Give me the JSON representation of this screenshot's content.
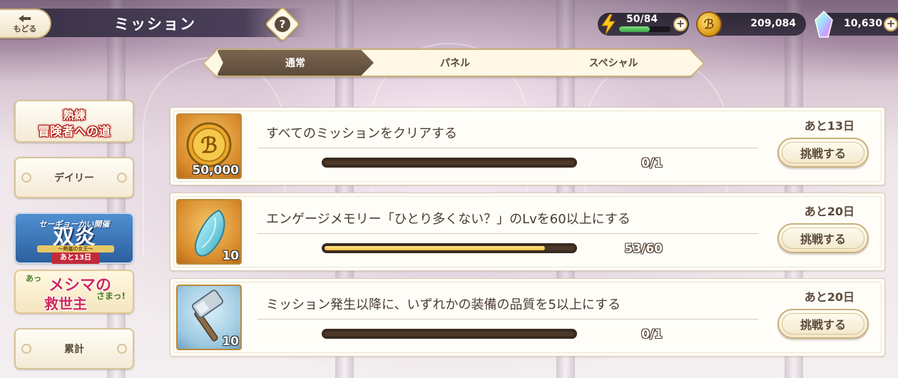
{
  "header": {
    "back_label": "もどる",
    "title": "ミッション",
    "help_glyph": "?"
  },
  "resources": {
    "stamina": "50/84",
    "stamina_fraction": 0.595,
    "coins": "209,084",
    "gems": "10,630",
    "plus": "+"
  },
  "tabs": [
    {
      "label": "通常",
      "active": true
    },
    {
      "label": "パネル",
      "active": false
    },
    {
      "label": "スペシャル",
      "active": false
    }
  ],
  "sidebar": {
    "skill_banner_line1": "熟練",
    "skill_banner_line2": "冒険者への道",
    "daily_label": "デイリー",
    "event_banner_sub": "セーギョーかい開催 ",
    "event_banner_title": "双炎",
    "event_banner_ribbon": "～熱嵐の女王～",
    "event_banner_tag": "あと13日",
    "mesima_prefix": "あっ",
    "mesima_line1": "メシマの",
    "mesima_line2": "救世主",
    "mesima_suffix": "さまっ!",
    "cumulative_label": "累計"
  },
  "missions": [
    {
      "reward_icon": "gold-coin-icon",
      "reward_qty": "50,000",
      "text": "すべてのミッションをクリアする",
      "progress": "0/1",
      "progress_fraction": 0.0,
      "remaining": "あと13日",
      "button": "挑戦する"
    },
    {
      "reward_icon": "memory-crystal-icon",
      "reward_qty": "10",
      "text": "エンゲージメモリー「ひとり多くない？」のLvを60以上にする",
      "progress": "53/60",
      "progress_fraction": 0.883,
      "remaining": "あと20日",
      "button": "挑戦する"
    },
    {
      "reward_icon": "hammer-icon",
      "reward_qty": "10",
      "text": "ミッション発生以降に、いずれかの装備の品質を5以上にする",
      "progress": "0/1",
      "progress_fraction": 0.0,
      "remaining": "あと20日",
      "button": "挑戦する"
    }
  ],
  "colors": {
    "accent_brown": "#5e4b3a",
    "progress_fill": "#f2c040",
    "border_gold": "#c9b07a",
    "stamina_green": "#3aa64a"
  }
}
